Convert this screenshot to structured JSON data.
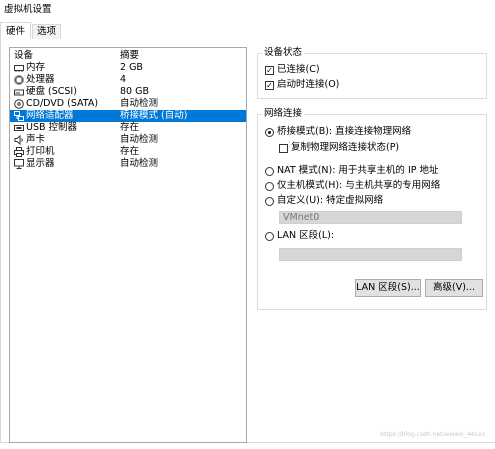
{
  "window": {
    "title": "虚拟机设置"
  },
  "tabs": [
    {
      "label": "硬件"
    },
    {
      "label": "选项"
    }
  ],
  "device_list": {
    "header": {
      "device": "设备",
      "summary": "摘要"
    },
    "rows": [
      {
        "icon": "memory-icon",
        "name": "内存",
        "summary": "2 GB"
      },
      {
        "icon": "processor-icon",
        "name": "处理器",
        "summary": "4"
      },
      {
        "icon": "hard-disk-icon",
        "name": "硬盘 (SCSI)",
        "summary": "80 GB"
      },
      {
        "icon": "cd-dvd-icon",
        "name": "CD/DVD (SATA)",
        "summary": "自动检测"
      },
      {
        "icon": "network-adapter-icon",
        "name": "网络适配器",
        "summary": "桥接模式 (自动)"
      },
      {
        "icon": "usb-icon",
        "name": "USB 控制器",
        "summary": "存在"
      },
      {
        "icon": "sound-icon",
        "name": "声卡",
        "summary": "自动检测"
      },
      {
        "icon": "printer-icon",
        "name": "打印机",
        "summary": "存在"
      },
      {
        "icon": "display-icon",
        "name": "显示器",
        "summary": "自动检测"
      }
    ],
    "selected_index": 4
  },
  "device_status": {
    "title": "设备状态",
    "connected": {
      "label": "已连接(C)",
      "checked": true
    },
    "connect_at_power_on": {
      "label": "启动时连接(O)",
      "checked": true
    }
  },
  "network_connection": {
    "title": "网络连接",
    "bridged": {
      "label": "桥接模式(B): 直接连接物理网络",
      "selected": true
    },
    "replicate": {
      "label": "复制物理网络连接状态(P)",
      "checked": false
    },
    "nat": {
      "label": "NAT 模式(N): 用于共享主机的 IP 地址",
      "selected": false
    },
    "host_only": {
      "label": "仅主机模式(H): 与主机共享的专用网络",
      "selected": false
    },
    "custom": {
      "label": "自定义(U): 特定虚拟网络",
      "selected": false,
      "value": "VMnet0"
    },
    "lan_segment": {
      "label": "LAN 区段(L):",
      "selected": false,
      "value": ""
    }
  },
  "buttons": {
    "lan_segments": "LAN 区段(S)...",
    "advanced": "高级(V)..."
  },
  "watermark": "https://blog.csdn.net/weixin_44xxx"
}
